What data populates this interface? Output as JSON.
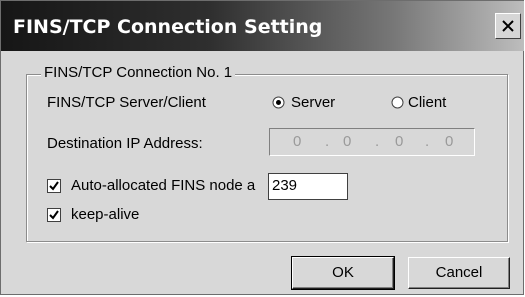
{
  "window": {
    "title": "FINS/TCP Connection Setting"
  },
  "group": {
    "legend": "FINS/TCP Connection No. 1"
  },
  "server_client": {
    "label": "FINS/TCP Server/Client",
    "options": [
      {
        "label": "Server",
        "selected": true
      },
      {
        "label": "Client",
        "selected": false
      }
    ]
  },
  "destination_ip": {
    "label": "Destination IP Address:",
    "octets": [
      "0",
      "0",
      "0",
      "0"
    ],
    "enabled": false
  },
  "auto_node": {
    "label": "Auto-allocated FINS node a",
    "checked": true,
    "value": "239"
  },
  "keep_alive": {
    "label": "keep-alive",
    "checked": true
  },
  "buttons": {
    "ok": "OK",
    "cancel": "Cancel"
  },
  "colors": {
    "dialog_bg": "#d8d8d8",
    "title_text": "#ffffff",
    "disabled_text": "#9a9a9a"
  },
  "icons": {
    "close": "close-icon",
    "check": "checkmark-icon",
    "radio": "radio-icon"
  }
}
